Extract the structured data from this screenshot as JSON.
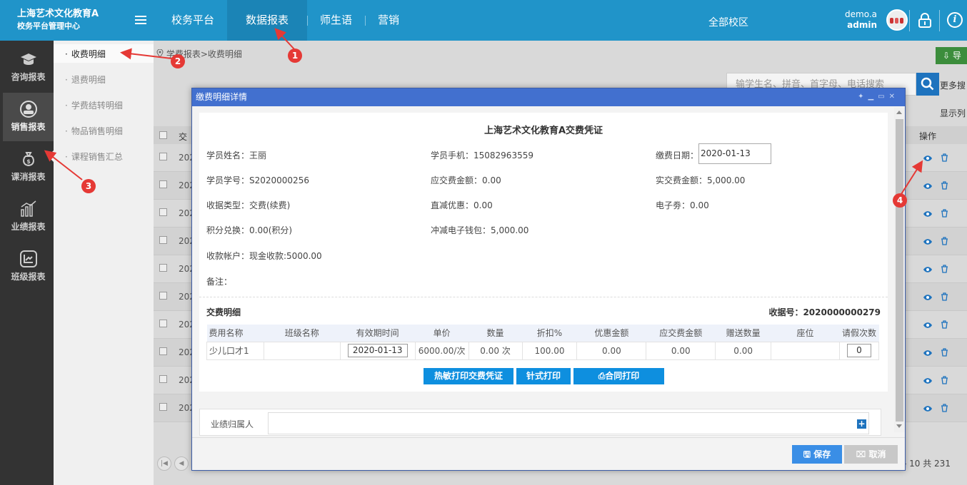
{
  "header": {
    "brand_title": "上海艺术文化教育A",
    "brand_subtitle": "校务平台管理中心",
    "nav": [
      {
        "label": "校务平台"
      },
      {
        "label": "数据报表"
      },
      {
        "label": "师生语"
      },
      {
        "label": "营销"
      }
    ],
    "campus": "全部校区",
    "user_name": "demo.a",
    "user_role": "admin"
  },
  "sidebar": {
    "items": [
      {
        "label": "咨询报表"
      },
      {
        "label": "销售报表"
      },
      {
        "label": "课消报表"
      },
      {
        "label": "业绩报表"
      },
      {
        "label": "班级报表"
      }
    ]
  },
  "submenu": {
    "items": [
      {
        "label": "收费明细"
      },
      {
        "label": "退费明细"
      },
      {
        "label": "学费结转明细"
      },
      {
        "label": "物品销售明细"
      },
      {
        "label": "课程销售汇总"
      }
    ]
  },
  "main": {
    "breadcrumb": "学费报表>收费明细",
    "export_label": "导",
    "search_placeholder": "输学生名、拼音、首字母、电话搜索",
    "more_search": "更多搜",
    "show_cols": "显示列",
    "col_first": "交",
    "col_ops": "操作",
    "row_date_prefix": "202",
    "pager_info": "- 10 共 231"
  },
  "modal": {
    "title": "缴费明细详情",
    "receipt_title": "上海艺术文化教育A交费凭证",
    "fields": {
      "student_name": "学员姓名：王丽",
      "student_phone": "学员手机：15082963559",
      "pay_date_label": "缴费日期：",
      "pay_date_value": "2020-01-13",
      "student_no": "学员学号：S2020000256",
      "amount_due": "应交费金额：0.00",
      "amount_paid": "实交费金额：5,000.00",
      "receipt_type": "收据类型：交费(续费)",
      "direct_discount": "直减优惠：0.00",
      "e_coupon": "电子劵：0.00",
      "points": "积分兑换：0.00(积分)",
      "wallet_deduct": "冲减电子钱包：5,000.00",
      "account": "收款帐户：现金收款:5000.00",
      "remark": "备注："
    },
    "section_title": "交费明细",
    "receipt_no": "收据号：2020000000279",
    "table": {
      "headers": [
        "费用名称",
        "班级名称",
        "有效期时间",
        "单价",
        "数量",
        "折扣%",
        "优惠金额",
        "应交费金额",
        "赠送数量",
        "座位",
        "请假次数"
      ],
      "row": {
        "fee_name": "少儿口才1",
        "class_name": "",
        "valid_date": "2020-01-13",
        "unit_price": "6000.00/次",
        "quantity": "0.00 次",
        "discount": "100.00",
        "discount_amount": "0.00",
        "amount_due": "0.00",
        "gift_qty": "0.00",
        "seat": "",
        "leave_count": "0"
      }
    },
    "buttons": {
      "thermal_print": "热敏打印交费凭证",
      "dot_print": "针式打印",
      "contract_print": "合同打印"
    },
    "performance_label": "业绩归属人",
    "save": "保存",
    "cancel": "取消"
  },
  "annotations": [
    "1",
    "2",
    "3",
    "4"
  ],
  "colors": {
    "topbar": "#2094c9",
    "modal_header": "#4270cf",
    "print_button": "#0e8fdf",
    "annotation": "#e53935"
  }
}
